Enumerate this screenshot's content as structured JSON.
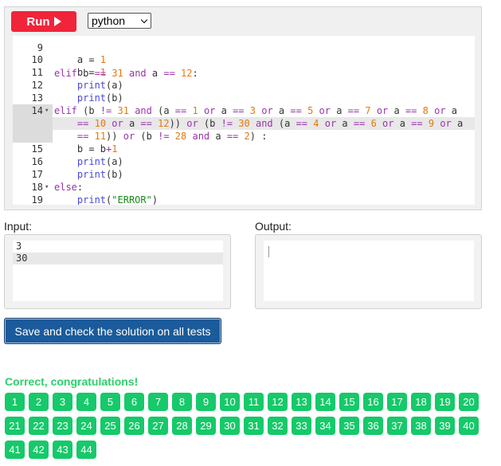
{
  "toolbar": {
    "run_label": "Run",
    "language": "python"
  },
  "editor": {
    "partial_top_line": "elif b == 31 and a == 12:",
    "lines": [
      {
        "n": "10",
        "fold": "",
        "tokens": [
          [
            "t",
            "    a = "
          ],
          [
            "num",
            "1"
          ]
        ]
      },
      {
        "n": "11",
        "fold": "",
        "tokens": [
          [
            "t",
            "    b = "
          ],
          [
            "num",
            "1"
          ]
        ]
      },
      {
        "n": "12",
        "fold": "",
        "tokens": [
          [
            "t",
            "    "
          ],
          [
            "fn",
            "print"
          ],
          [
            "t",
            "(a)"
          ]
        ]
      },
      {
        "n": "13",
        "fold": "",
        "tokens": [
          [
            "t",
            "    "
          ],
          [
            "fn",
            "print"
          ],
          [
            "t",
            "(b)"
          ]
        ]
      },
      {
        "n": "14",
        "fold": "▾",
        "tokens": [
          [
            "kw",
            "elif"
          ],
          [
            "t",
            " (b "
          ],
          [
            "op",
            "!="
          ],
          [
            "t",
            " "
          ],
          [
            "num",
            "31"
          ],
          [
            "t",
            " "
          ],
          [
            "kw",
            "and"
          ],
          [
            "t",
            " (a "
          ],
          [
            "op",
            "=="
          ],
          [
            "t",
            " "
          ],
          [
            "num",
            "1"
          ],
          [
            "t",
            " "
          ],
          [
            "kw",
            "or"
          ],
          [
            "t",
            " a "
          ],
          [
            "op",
            "=="
          ],
          [
            "t",
            " "
          ],
          [
            "num",
            "3"
          ],
          [
            "t",
            " "
          ],
          [
            "kw",
            "or"
          ],
          [
            "t",
            " a "
          ],
          [
            "op",
            "=="
          ],
          [
            "t",
            " "
          ],
          [
            "num",
            "5"
          ],
          [
            "t",
            " "
          ],
          [
            "kw",
            "or"
          ],
          [
            "t",
            " a "
          ],
          [
            "op",
            "=="
          ],
          [
            "t",
            " "
          ],
          [
            "num",
            "7"
          ],
          [
            "t",
            " "
          ],
          [
            "kw",
            "or"
          ],
          [
            "t",
            " a "
          ],
          [
            "op",
            "=="
          ],
          [
            "t",
            " "
          ],
          [
            "num",
            "8"
          ],
          [
            "t",
            " "
          ],
          [
            "kw",
            "or"
          ],
          [
            "t",
            " a"
          ]
        ]
      },
      {
        "n": "",
        "fold": "",
        "tokens": [
          [
            "t",
            "    "
          ],
          [
            "op",
            "=="
          ],
          [
            "t",
            " "
          ],
          [
            "num",
            "10"
          ],
          [
            "t",
            " "
          ],
          [
            "kw",
            "or"
          ],
          [
            "t",
            " a "
          ],
          [
            "op",
            "=="
          ],
          [
            "t",
            " "
          ],
          [
            "num",
            "12"
          ],
          [
            "t",
            ")) "
          ],
          [
            "kw",
            "or"
          ],
          [
            "t",
            " (b "
          ],
          [
            "op",
            "!="
          ],
          [
            "t",
            " "
          ],
          [
            "num",
            "30"
          ],
          [
            "t",
            " "
          ],
          [
            "kw",
            "and"
          ],
          [
            "t",
            " (a "
          ],
          [
            "op",
            "=="
          ],
          [
            "t",
            " "
          ],
          [
            "num",
            "4"
          ],
          [
            "t",
            " "
          ],
          [
            "kw",
            "or"
          ],
          [
            "t",
            " a "
          ],
          [
            "op",
            "=="
          ],
          [
            "t",
            " "
          ],
          [
            "num",
            "6"
          ],
          [
            "t",
            " "
          ],
          [
            "kw",
            "or"
          ],
          [
            "t",
            " a "
          ],
          [
            "op",
            "=="
          ],
          [
            "t",
            " "
          ],
          [
            "num",
            "9"
          ],
          [
            "t",
            " "
          ],
          [
            "kw",
            "or"
          ],
          [
            "t",
            " a"
          ]
        ]
      },
      {
        "n": "",
        "fold": "",
        "tokens": [
          [
            "t",
            "    "
          ],
          [
            "op",
            "=="
          ],
          [
            "t",
            " "
          ],
          [
            "num",
            "11"
          ],
          [
            "t",
            ")) "
          ],
          [
            "kw",
            "or"
          ],
          [
            "t",
            " (b "
          ],
          [
            "op",
            "!="
          ],
          [
            "t",
            " "
          ],
          [
            "num",
            "28"
          ],
          [
            "t",
            " "
          ],
          [
            "kw",
            "and"
          ],
          [
            "t",
            " a "
          ],
          [
            "op",
            "=="
          ],
          [
            "t",
            " "
          ],
          [
            "num",
            "2"
          ],
          [
            "t",
            ") :"
          ]
        ]
      },
      {
        "n": "15",
        "fold": "",
        "tokens": [
          [
            "t",
            "    b = b"
          ],
          [
            "op",
            "+"
          ],
          [
            "num",
            "1"
          ]
        ]
      },
      {
        "n": "16",
        "fold": "",
        "tokens": [
          [
            "t",
            "    "
          ],
          [
            "fn",
            "print"
          ],
          [
            "t",
            "(a)"
          ]
        ]
      },
      {
        "n": "17",
        "fold": "",
        "tokens": [
          [
            "t",
            "    "
          ],
          [
            "fn",
            "print"
          ],
          [
            "t",
            "(b)"
          ]
        ]
      },
      {
        "n": "18",
        "fold": "▾",
        "tokens": [
          [
            "kw",
            "else"
          ],
          [
            "t",
            ":"
          ]
        ]
      },
      {
        "n": "19",
        "fold": "",
        "tokens": [
          [
            "t",
            "    "
          ],
          [
            "fn",
            "print"
          ],
          [
            "t",
            "("
          ],
          [
            "str",
            "\"ERROR\""
          ],
          [
            "t",
            ")"
          ]
        ]
      }
    ]
  },
  "input": {
    "label": "Input:",
    "lines": [
      "3",
      "30"
    ]
  },
  "output": {
    "label": "Output:"
  },
  "save_button": "Save and check the solution on all tests",
  "result_message": "Correct, congratulations!",
  "tests": [
    "1",
    "2",
    "3",
    "4",
    "5",
    "6",
    "7",
    "8",
    "9",
    "10",
    "11",
    "12",
    "13",
    "14",
    "15",
    "16",
    "17",
    "18",
    "19",
    "20",
    "21",
    "22",
    "23",
    "24",
    "25",
    "26",
    "27",
    "28",
    "29",
    "30",
    "31",
    "32",
    "33",
    "34",
    "35",
    "36",
    "37",
    "38",
    "39",
    "40",
    "41",
    "42",
    "43",
    "44"
  ],
  "colors": {
    "run": "#f0243a",
    "save": "#1b5b9b",
    "success": "#2ecf6a",
    "test_pass": "#16c96a"
  }
}
